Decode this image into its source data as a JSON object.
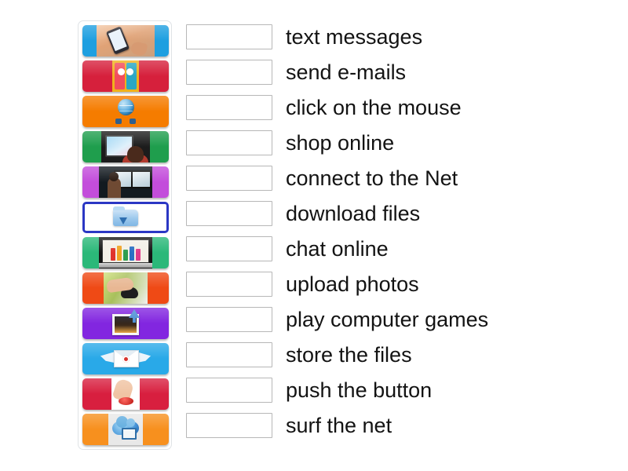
{
  "activity": {
    "type": "match-up",
    "tile_count": 12,
    "row_count": 12
  },
  "tiles": [
    {
      "name": "texting-on-phone",
      "color": "#1e9fe0",
      "selected": false
    },
    {
      "name": "two-phones-messaging",
      "color": "#d6203c",
      "selected": false
    },
    {
      "name": "globe-with-cables",
      "color": "#f57c00",
      "selected": false
    },
    {
      "name": "person-at-monitor",
      "color": "#1f9e4d",
      "selected": false
    },
    {
      "name": "internet-cafe",
      "color": "#c34ddb",
      "selected": false
    },
    {
      "name": "download-folder",
      "color": "#ffffff",
      "selected": true
    },
    {
      "name": "shopping-bags-on-screen",
      "color": "#2bb879",
      "selected": false
    },
    {
      "name": "hand-on-mouse",
      "color": "#ef4a15",
      "selected": false
    },
    {
      "name": "upload-photo",
      "color": "#8226e0",
      "selected": false
    },
    {
      "name": "winged-envelope",
      "color": "#29a9e8",
      "selected": false
    },
    {
      "name": "finger-pushing-button",
      "color": "#d81f3f",
      "selected": false
    },
    {
      "name": "cloud-computer",
      "color": "#f7901e",
      "selected": false
    }
  ],
  "rows": [
    {
      "answer": "",
      "label": "text messages"
    },
    {
      "answer": "",
      "label": "send e-mails"
    },
    {
      "answer": "",
      "label": "click on the mouse"
    },
    {
      "answer": "",
      "label": "shop online"
    },
    {
      "answer": "",
      "label": "connect to the Net"
    },
    {
      "answer": "",
      "label": "download files"
    },
    {
      "answer": "",
      "label": "chat online"
    },
    {
      "answer": "",
      "label": "upload photos"
    },
    {
      "answer": "",
      "label": "play computer games"
    },
    {
      "answer": "",
      "label": "store the files"
    },
    {
      "answer": "",
      "label": "push the button"
    },
    {
      "answer": "",
      "label": "surf the net"
    }
  ],
  "colors": {
    "page_background": "#ffffff",
    "panel_border": "#dfe3e6",
    "dropbox_border": "#b7b7b7",
    "label_text": "#131313",
    "selected_tile_border": "#2b37c4"
  }
}
